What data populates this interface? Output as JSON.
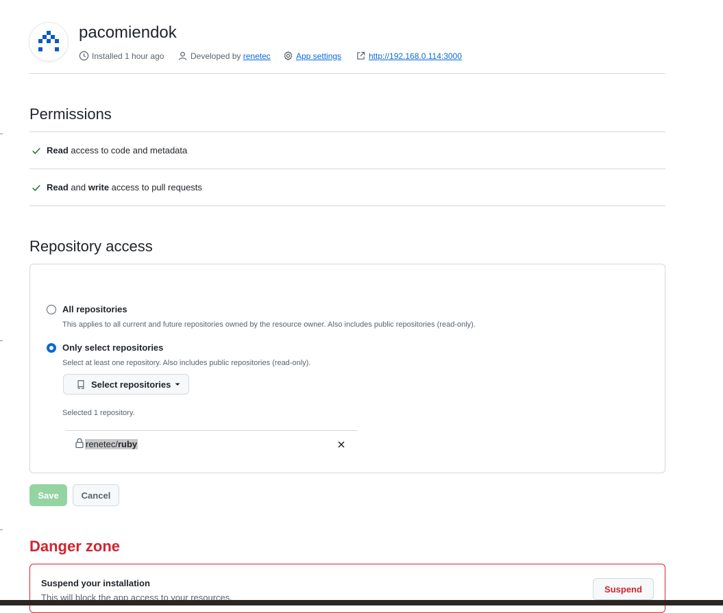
{
  "app": {
    "name": "pacomiendok",
    "installed": "Installed 1 hour ago",
    "developed_by_prefix": "Developed by",
    "developer": "renetec",
    "settings_link": "App settings",
    "url": "http://192.168.0.114:3000"
  },
  "permissions": {
    "title": "Permissions",
    "items": [
      {
        "parts": [
          {
            "text": "Read",
            "bold": true
          },
          {
            "text": " access to code and metadata",
            "bold": false
          }
        ]
      },
      {
        "parts": [
          {
            "text": "Read",
            "bold": true
          },
          {
            "text": " and ",
            "bold": false
          },
          {
            "text": "write",
            "bold": true
          },
          {
            "text": " access to pull requests",
            "bold": false
          }
        ]
      }
    ]
  },
  "repository_access": {
    "title": "Repository access",
    "options": [
      {
        "label": "All repositories",
        "description": "This applies to all current and future repositories owned by the resource owner. Also includes public repositories (read-only).",
        "selected": false
      },
      {
        "label": "Only select repositories",
        "description": "Select at least one repository. Also includes public repositories (read-only).",
        "selected": true
      }
    ],
    "select_button": "Select repositories",
    "selected_count_text": "Selected 1 repository.",
    "repos": [
      {
        "owner": "renetec/",
        "name": "ruby"
      }
    ]
  },
  "actions": {
    "save": "Save",
    "cancel": "Cancel"
  },
  "danger_zone": {
    "title": "Danger zone",
    "suspend_title": "Suspend your installation",
    "suspend_desc": "This will block the app access to your resources.",
    "suspend_button": "Suspend"
  },
  "colors": {
    "accent": "#0969da",
    "success": "#1a7f37",
    "danger": "#d1242f",
    "save_disabled": "#94d3a2"
  },
  "icons": [
    "app-logo-icon",
    "clock-icon",
    "person-icon",
    "gear-icon",
    "link-external-icon",
    "check-icon",
    "repo-icon",
    "triangle-down-icon",
    "lock-icon",
    "x-icon"
  ]
}
